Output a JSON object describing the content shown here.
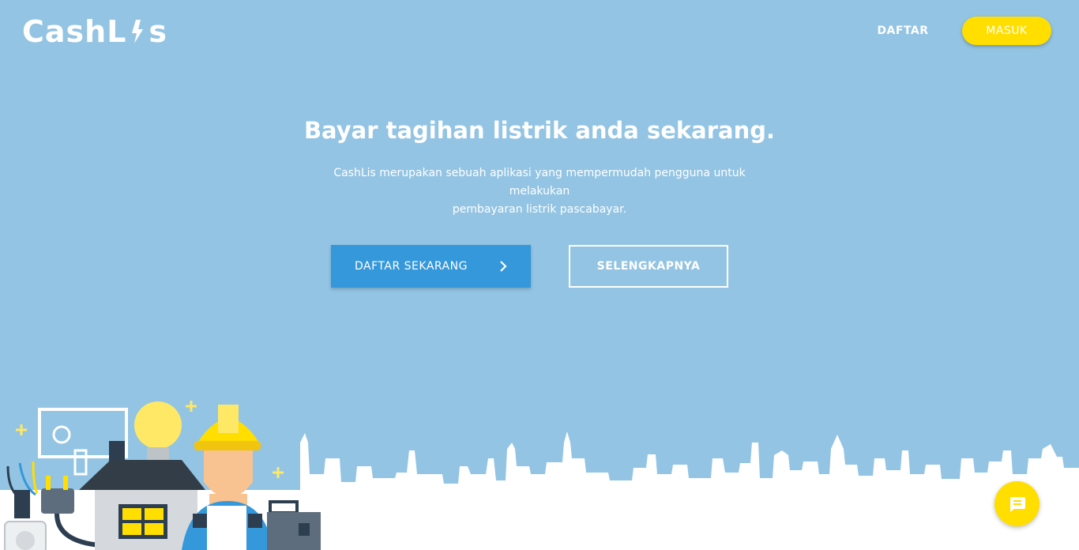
{
  "header": {
    "logo_text_left": "CashL",
    "logo_text_right": "s",
    "nav_daftar": "DAFTAR",
    "nav_masuk": "MASUK"
  },
  "hero": {
    "title": "Bayar tagihan listrik anda sekarang.",
    "subtitle_line1": "CashLis merupakan sebuah aplikasi yang mempermudah pengguna untuk melakukan",
    "subtitle_line2": "pembayaran listrik pascabayar.",
    "primary_button": "DAFTAR SEKARANG",
    "secondary_button": "SELENGKAPNYA"
  },
  "icons": {
    "logo_bolt": "lightning-bolt-icon",
    "primary_button_icon": "chevron-right-icon",
    "chat": "chat-icon"
  },
  "colors": {
    "background": "#93c4e3",
    "accent_yellow": "#ffde00",
    "primary_blue": "#3498db",
    "text": "#ffffff"
  }
}
